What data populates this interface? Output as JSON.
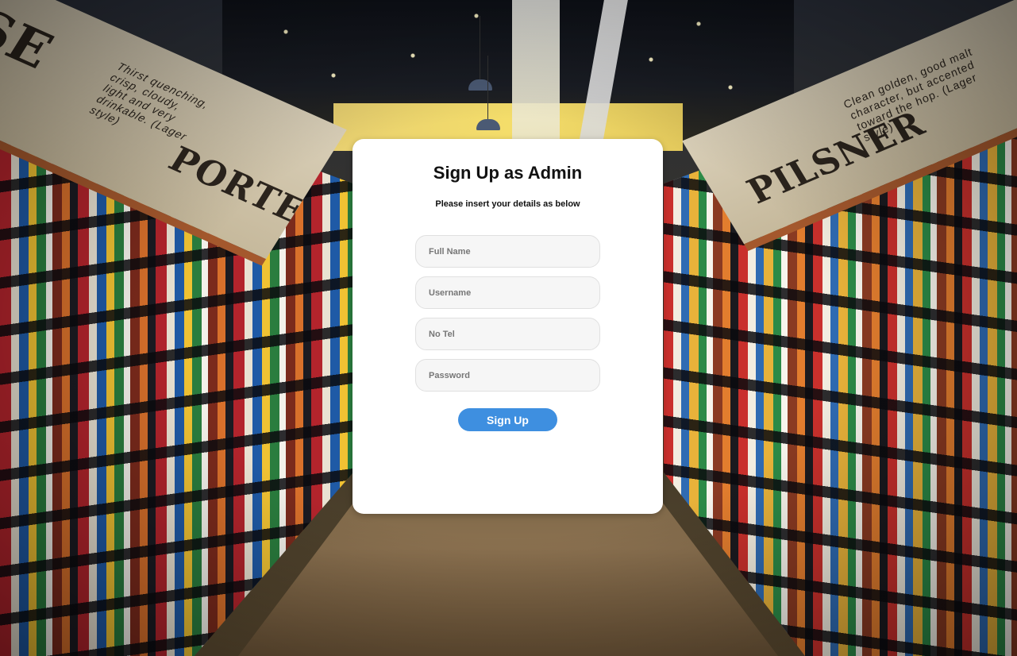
{
  "form": {
    "title": "Sign Up as Admin",
    "subtitle": "Please insert your details as below",
    "fields": {
      "full_name": {
        "placeholder": "Full Name",
        "value": ""
      },
      "username": {
        "placeholder": "Username",
        "value": ""
      },
      "phone": {
        "placeholder": "No Tel",
        "value": ""
      },
      "password": {
        "placeholder": "Password",
        "value": ""
      }
    },
    "submit_label": "Sign Up"
  },
  "background": {
    "banner_left_word_1": "SE",
    "banner_left_word_2": "PORTER",
    "banner_left_desc": "Thirst quenching, crisp, cloudy, light and very drinkable. (Lager style)",
    "banner_right_word": "PILSNER",
    "banner_right_desc": "Clean golden, good malt character, but accented toward the hop. (Lager style)"
  },
  "colors": {
    "accent": "#3e8fe0",
    "card": "#ffffff",
    "field_bg": "#f6f6f6"
  }
}
